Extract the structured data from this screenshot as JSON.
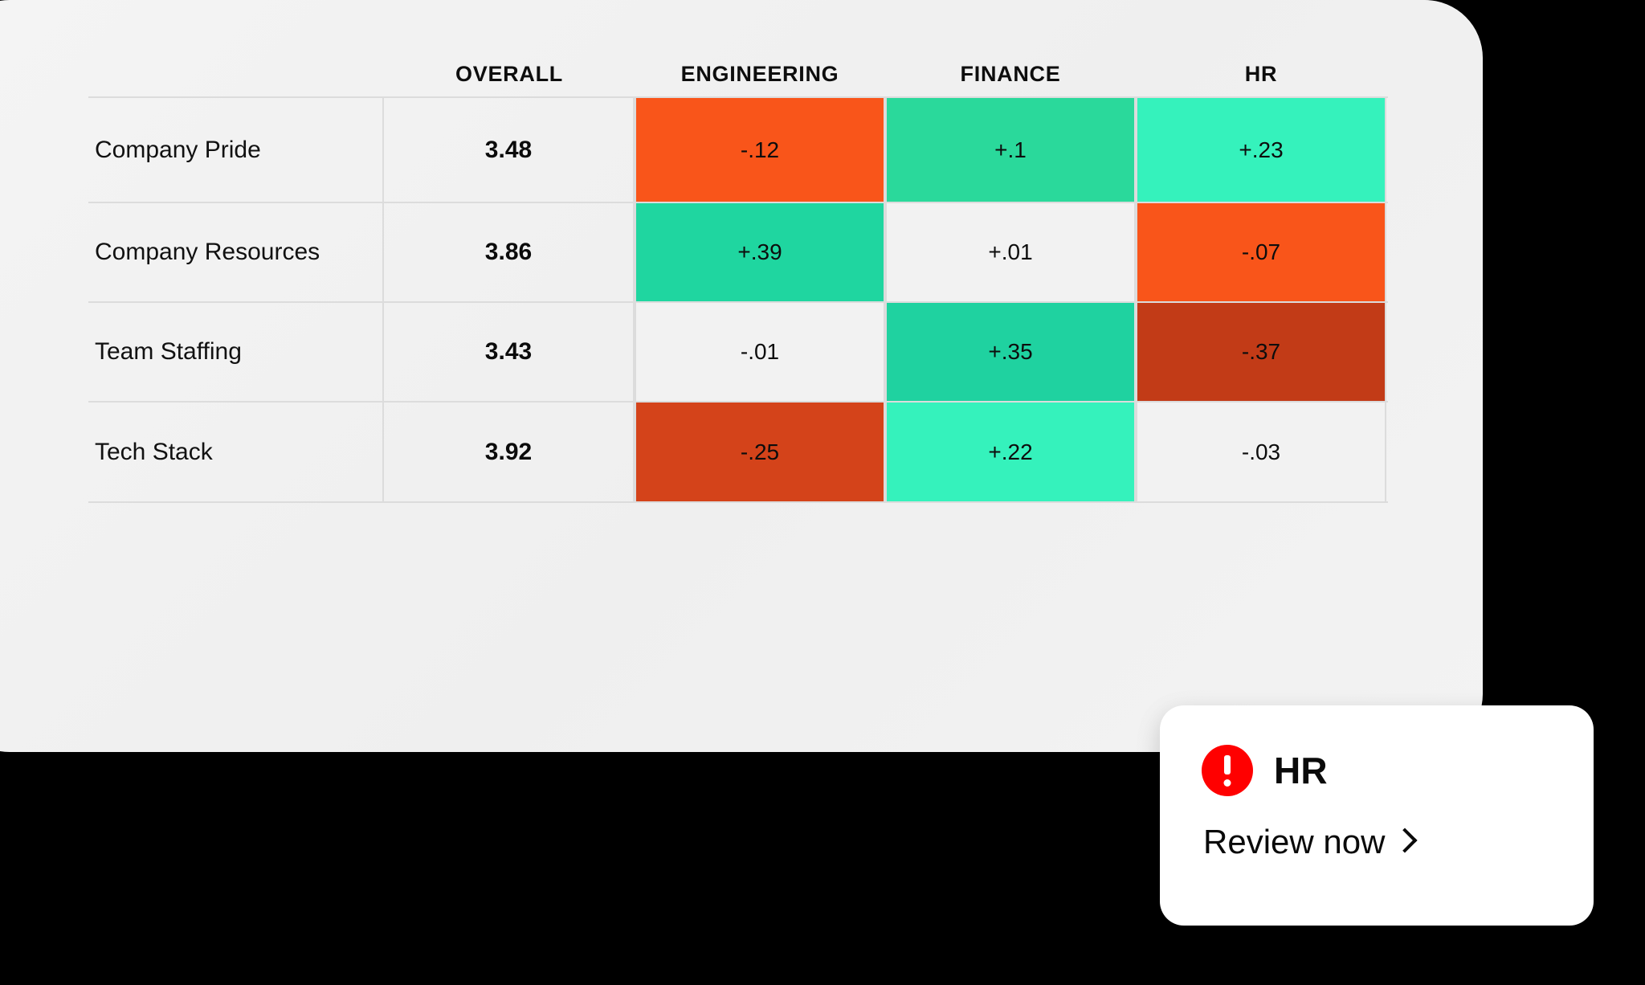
{
  "card": {
    "background_color": "#f1f1f1"
  },
  "table": {
    "headers": {
      "label": "",
      "overall": "OVERALL",
      "engineering": "ENGINEERING",
      "finance": "FINANCE",
      "hr": "HR"
    },
    "rows": [
      {
        "label": "Company Pride",
        "overall": "3.48",
        "engineering": "-.12",
        "finance": "+.1",
        "hr": "+.23"
      },
      {
        "label": "Company Resources",
        "overall": "3.86",
        "engineering": "+.39",
        "finance": "+.01",
        "hr": "-.07"
      },
      {
        "label": "Team Staffing",
        "overall": "3.43",
        "engineering": "-.01",
        "finance": "+.35",
        "hr": "-.37"
      },
      {
        "label": "Tech Stack",
        "overall": "3.92",
        "engineering": "-.25",
        "finance": "+.22",
        "hr": "-.03"
      }
    ]
  },
  "notification": {
    "icon": "alert-exclamation-icon",
    "title": "HR",
    "link_label": "Review now",
    "chevron": "chevron-right-icon",
    "accent_color": "#ff0000"
  },
  "chart_data": {
    "type": "heatmap",
    "title": "",
    "xlabel": "",
    "ylabel": "",
    "categories": [
      "ENGINEERING",
      "FINANCE",
      "HR"
    ],
    "rows": [
      "Company Pride",
      "Company Resources",
      "Team Staffing",
      "Tech Stack"
    ],
    "overall_scores": [
      3.48,
      3.86,
      3.43,
      3.92
    ],
    "values": [
      [
        -0.12,
        0.1,
        0.23
      ],
      [
        0.39,
        0.01,
        -0.07
      ],
      [
        -0.01,
        0.35,
        -0.37
      ],
      [
        -0.25,
        0.22,
        -0.03
      ]
    ],
    "value_labels": [
      [
        "-.12",
        "+.1",
        "+.23"
      ],
      [
        "+.39",
        "+.01",
        "-.07"
      ],
      [
        "-.01",
        "+.35",
        "-.37"
      ],
      [
        "-.25",
        "+.22",
        "-.03"
      ]
    ],
    "cell_colors": [
      [
        "#f9551a",
        "#2ad99b",
        "#35f2bc"
      ],
      [
        "#1fd6a0",
        "#f2f2f2",
        "#f9551a"
      ],
      [
        "#f2f2f2",
        "#1fd2a0",
        "#c23b17"
      ],
      [
        "#d4431a",
        "#35f2bc",
        "#f2f2f2"
      ]
    ],
    "colorscale": {
      "strong_negative": "#c23b17",
      "negative": "#f9551a",
      "neutral": "#f2f2f2",
      "positive": "#1fd6a0",
      "strong_positive": "#35f2bc"
    },
    "grid": true,
    "legend": "none"
  }
}
